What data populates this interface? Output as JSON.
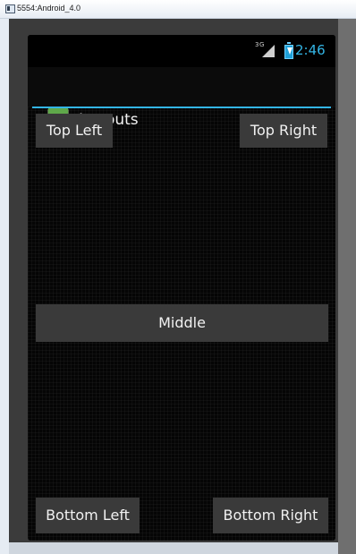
{
  "window": {
    "title": "5554:Android_4.0"
  },
  "status_bar": {
    "network_label": "3G",
    "time": "2:46",
    "icons": [
      "signal-icon",
      "battery-charging-icon"
    ],
    "clock_color": "#33b5e5"
  },
  "action_bar": {
    "app_icon": "android-launcher-icon",
    "title": "Layouts",
    "accent_color": "#33b5e5"
  },
  "buttons": {
    "top_left": "Top Left",
    "top_right": "Top Right",
    "middle": "Middle",
    "bottom_left": "Bottom Left",
    "bottom_right": "Bottom Right"
  }
}
